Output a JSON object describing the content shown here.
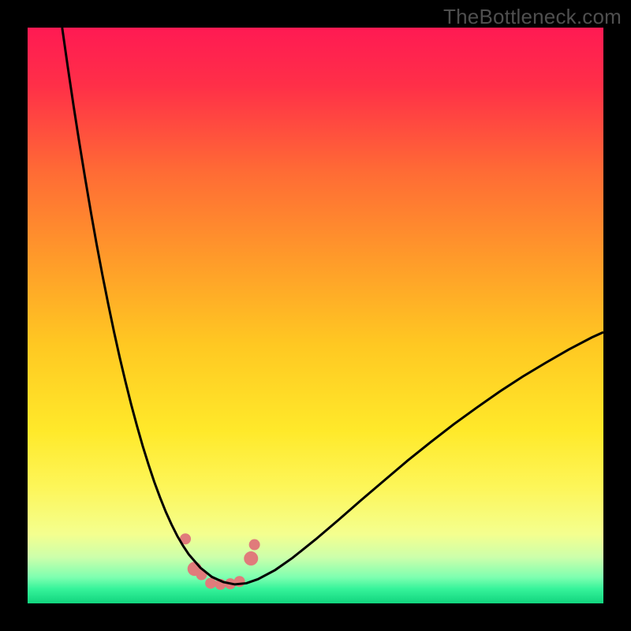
{
  "watermark": "TheBottleneck.com",
  "chart_data": {
    "type": "line",
    "title": "",
    "xlabel": "",
    "ylabel": "",
    "xlim": [
      0,
      100
    ],
    "ylim": [
      0,
      100
    ],
    "background_gradient_stops": [
      {
        "offset": 0.0,
        "color": "#ff1a53"
      },
      {
        "offset": 0.1,
        "color": "#ff2f48"
      },
      {
        "offset": 0.25,
        "color": "#ff6b35"
      },
      {
        "offset": 0.4,
        "color": "#ff9a2a"
      },
      {
        "offset": 0.55,
        "color": "#ffc822"
      },
      {
        "offset": 0.7,
        "color": "#ffe92a"
      },
      {
        "offset": 0.8,
        "color": "#fdf65a"
      },
      {
        "offset": 0.88,
        "color": "#f4ff8f"
      },
      {
        "offset": 0.92,
        "color": "#ccffab"
      },
      {
        "offset": 0.955,
        "color": "#7dffb0"
      },
      {
        "offset": 0.975,
        "color": "#35f39a"
      },
      {
        "offset": 1.0,
        "color": "#12d47e"
      }
    ],
    "series": [
      {
        "name": "bottleneck-curve",
        "color": "#000000",
        "stroke_width": 3,
        "x": [
          6,
          7,
          8,
          9,
          10,
          11,
          12,
          13,
          14,
          15,
          16,
          17,
          18,
          19,
          20,
          21,
          22,
          23,
          24,
          25,
          26,
          27,
          28,
          30,
          32,
          34,
          36,
          38,
          40,
          43,
          46,
          50,
          54,
          58,
          62,
          66,
          70,
          74,
          78,
          82,
          86,
          90,
          94,
          98,
          100
        ],
        "y": [
          100,
          93.0,
          86.3,
          79.9,
          73.8,
          67.9,
          62.3,
          57.0,
          52.0,
          47.2,
          42.7,
          38.5,
          34.5,
          30.8,
          27.3,
          24.1,
          21.1,
          18.4,
          15.9,
          13.7,
          11.7,
          10.0,
          8.5,
          6.2,
          4.6,
          3.7,
          3.3,
          3.5,
          4.2,
          5.8,
          7.9,
          11.1,
          14.5,
          18.0,
          21.4,
          24.8,
          28.0,
          31.1,
          34.0,
          36.8,
          39.4,
          41.8,
          44.1,
          46.2,
          47.1
        ]
      }
    ],
    "markers": [
      {
        "x": 27.4,
        "y": 11.2,
        "r": 7,
        "color": "#e07b7b"
      },
      {
        "x": 29.0,
        "y": 6.0,
        "r": 9,
        "color": "#e07b7b"
      },
      {
        "x": 30.2,
        "y": 5.0,
        "r": 7,
        "color": "#e07b7b"
      },
      {
        "x": 31.8,
        "y": 3.5,
        "r": 7,
        "color": "#e07b7b"
      },
      {
        "x": 33.5,
        "y": 3.3,
        "r": 7,
        "color": "#e07b7b"
      },
      {
        "x": 35.2,
        "y": 3.4,
        "r": 7,
        "color": "#e07b7b"
      },
      {
        "x": 36.8,
        "y": 3.8,
        "r": 7,
        "color": "#e07b7b"
      },
      {
        "x": 38.8,
        "y": 7.8,
        "r": 9,
        "color": "#e07b7b"
      },
      {
        "x": 39.4,
        "y": 10.2,
        "r": 7,
        "color": "#e07b7b"
      }
    ]
  }
}
